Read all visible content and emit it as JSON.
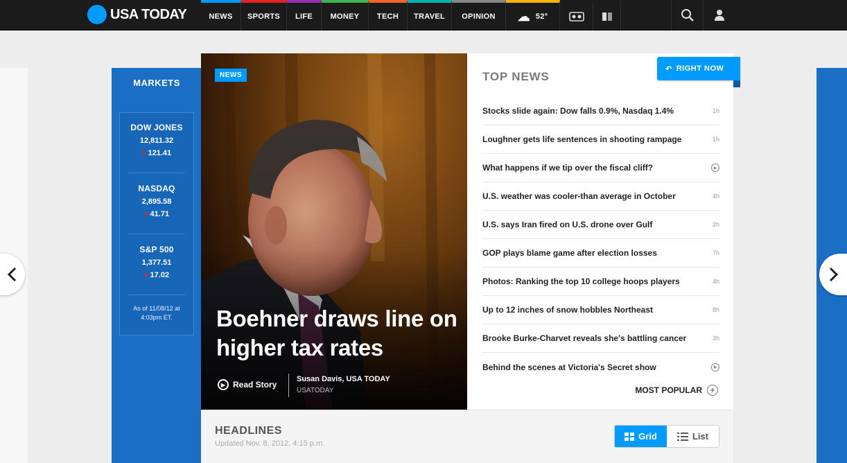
{
  "brand": {
    "name": "USA TODAY",
    "accent": "#009bff"
  },
  "nav": {
    "items": [
      {
        "label": "NEWS",
        "color": "#009bff"
      },
      {
        "label": "SPORTS",
        "color": "#e8231b"
      },
      {
        "label": "LIFE",
        "color": "#9c2cb6"
      },
      {
        "label": "MONEY",
        "color": "#3db54a"
      },
      {
        "label": "TECH",
        "color": "#f26522"
      },
      {
        "label": "TRAVEL",
        "color": "#00b5ad"
      },
      {
        "label": "OPINION",
        "color": "#888888"
      }
    ],
    "weather": {
      "temp": "52°",
      "icon": "weather-cloud-icon",
      "color": "#f4b400"
    },
    "icons": [
      "media-icon",
      "newspaper-icon",
      "search-icon",
      "user-icon"
    ]
  },
  "markets": {
    "title": "MARKETS",
    "indexes": [
      {
        "name": "DOW JONES",
        "value": "12,811.32",
        "change": "121.41",
        "direction": "down"
      },
      {
        "name": "NASDAQ",
        "value": "2,895.58",
        "change": "41.71",
        "direction": "down"
      },
      {
        "name": "S&P 500",
        "value": "1,377.51",
        "change": "17.02",
        "direction": "down"
      }
    ],
    "as_of_line1": "As of 11/08/12 at",
    "as_of_line2": "4:03pm ET."
  },
  "hero": {
    "tag": "NEWS",
    "headline": "Boehner draws line on higher tax rates",
    "read_story": "Read Story",
    "author": "Susan Davis, USA TODAY",
    "source": "USATODAY"
  },
  "top_news": {
    "title": "TOP NEWS",
    "right_now": "RIGHT NOW",
    "items": [
      {
        "title": "Stocks slide again: Dow falls 0.9%, Nasdaq 1.4%",
        "time": "1h"
      },
      {
        "title": "Loughner gets life sentences in shooting rampage",
        "time": "1h"
      },
      {
        "title": "What happens if we tip over the fiscal cliff?",
        "time": "",
        "video": true
      },
      {
        "title": "U.S. weather was cooler-than average in October",
        "time": "4h"
      },
      {
        "title": "U.S. says Iran fired on U.S. drone over Gulf",
        "time": "2h"
      },
      {
        "title": "GOP plays blame game after election losses",
        "time": "7h"
      },
      {
        "title": "Photos: Ranking the top 10 college hoops players",
        "time": "4h"
      },
      {
        "title": "Up to 12 inches of snow hobbles Northeast",
        "time": "8h"
      },
      {
        "title": "Brooke Burke-Charvet reveals she's battling cancer",
        "time": "3h"
      },
      {
        "title": "Behind the scenes at Victoria's Secret show",
        "time": "",
        "video": true
      }
    ],
    "most_popular": "MOST POPULAR"
  },
  "headlines": {
    "title": "HEADLINES",
    "updated": "Updated Nov. 8, 2012, 4:15 p.m.",
    "view_grid": "Grid",
    "view_list": "List"
  }
}
